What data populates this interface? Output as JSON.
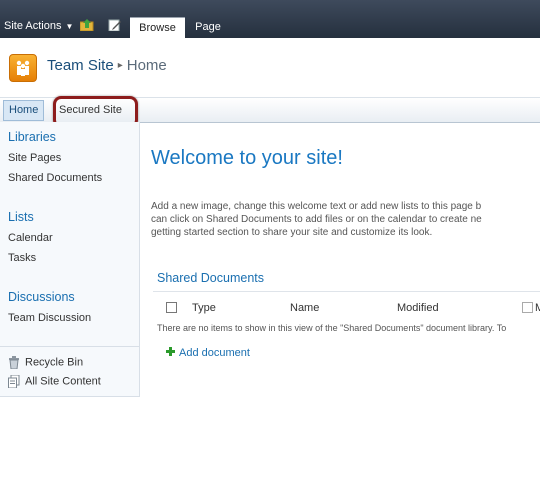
{
  "ribbon": {
    "site_actions": "Site Actions",
    "tabs": [
      {
        "label": "Browse"
      },
      {
        "label": "Page"
      }
    ]
  },
  "header": {
    "site_title": "Team Site",
    "separator": "▸",
    "page_title": "Home"
  },
  "topnav": {
    "items": [
      {
        "label": "Home"
      },
      {
        "label": "Secured Site"
      }
    ]
  },
  "quick_launch": {
    "sections": [
      {
        "heading": "Libraries",
        "items": [
          "Site Pages",
          "Shared Documents"
        ]
      },
      {
        "heading": "Lists",
        "items": [
          "Calendar",
          "Tasks"
        ]
      },
      {
        "heading": "Discussions",
        "items": [
          "Team Discussion"
        ]
      }
    ],
    "bottom": [
      "Recycle Bin",
      "All Site Content"
    ]
  },
  "main": {
    "welcome": "Welcome to your site!",
    "intro": "Add a new image, change this welcome text or add new lists to this page b\ncan click on Shared Documents to add files or on the calendar to create ne\ngetting started section to share your site and customize its look.",
    "library": {
      "title": "Shared Documents",
      "columns": [
        "Type",
        "Name",
        "Modified",
        "M"
      ],
      "empty_message": "There are no items to show in this view of the \"Shared Documents\" document library. To",
      "add_link": "Add document"
    }
  },
  "colors": {
    "ribbon": "#2b3645",
    "link_blue": "#1a6fb0",
    "highlight": "#8d1c1c",
    "logo_orange": "#f39c12"
  }
}
